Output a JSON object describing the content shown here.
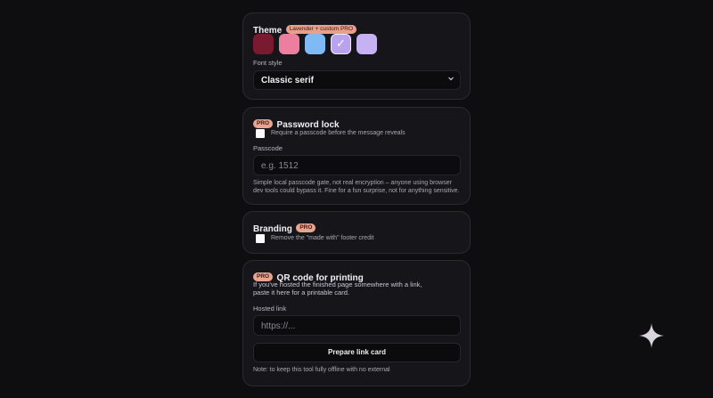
{
  "theme": {
    "title": "Theme",
    "badge": "Lavender + custom PRO",
    "swatches": [
      "#7a1a30",
      "#ec7fa0",
      "#7fbaf5",
      "#b9a2ee",
      "#c6b2f2"
    ],
    "selected_swatch_check": "✓",
    "font_style_label": "Font style",
    "font_style_value": "Classic serif"
  },
  "password": {
    "pro_badge": "PRO",
    "title": "Password lock",
    "checkbox_label": "Require a passcode before the message reveals",
    "passcode_label": "Passcode",
    "passcode_placeholder": "e.g. 1512",
    "note_line1": "Simple local passcode gate, not real encryption – anyone using browser",
    "note_line2": "dev tools could bypass it. Fine for a fun surprise, not for anything sensitive."
  },
  "branding": {
    "title": "Branding",
    "pro_badge": "PRO",
    "checkbox_label": "Remove the \"made with\" footer credit"
  },
  "qr": {
    "pro_badge": "PRO",
    "title": "QR code for printing",
    "desc_line1": "If you've hosted the finished page somewhere with a link,",
    "desc_line2": "paste it here for a printable card.",
    "hosted_label": "Hosted link",
    "hosted_placeholder": "https://...",
    "button_label": "Prepare link card",
    "note": "Note: to keep this tool fully offline with no external"
  },
  "sparkle_icon": "sparkle-icon"
}
